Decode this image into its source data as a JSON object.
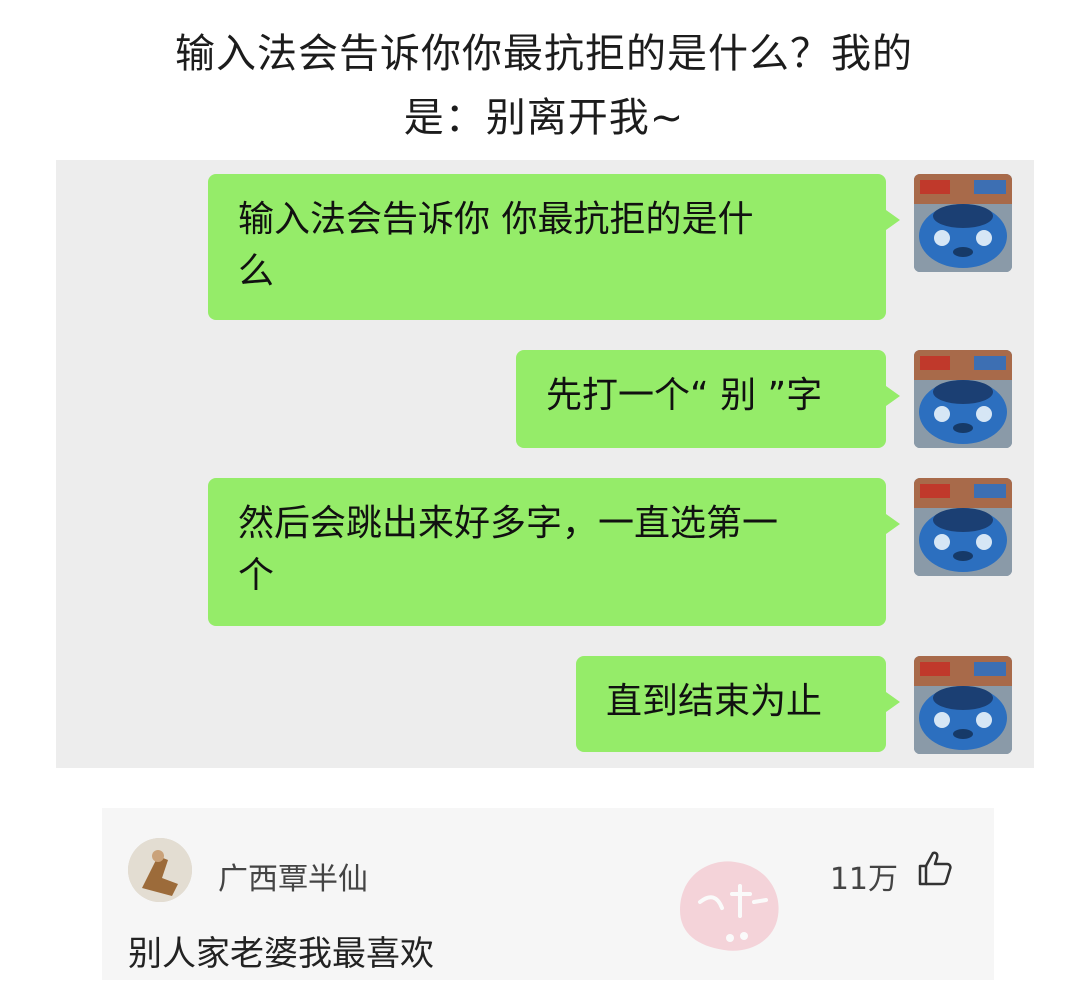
{
  "headline": {
    "line1": "输入法会告诉你你最抗拒的是什么？我的",
    "line2": "是：别离开我~"
  },
  "chat": {
    "messages": [
      {
        "line1": "输入法会告诉你   你最抗拒的是什",
        "line2": "么"
      },
      {
        "line1": "先打一个“ 别 ”字",
        "line2": ""
      },
      {
        "line1": "然后会跳出来好多字，一直选第一",
        "line2": "个"
      },
      {
        "line1": "直到结束为止",
        "line2": ""
      }
    ],
    "avatar_icon": "blue-car-avatar-icon",
    "colors": {
      "bubble": "#95ec69",
      "panel": "#ededed"
    }
  },
  "comment": {
    "username": "广西覃半仙",
    "likes": "11万",
    "text": "别人家老婆我最喜欢",
    "like_icon": "thumbs-up-icon"
  }
}
